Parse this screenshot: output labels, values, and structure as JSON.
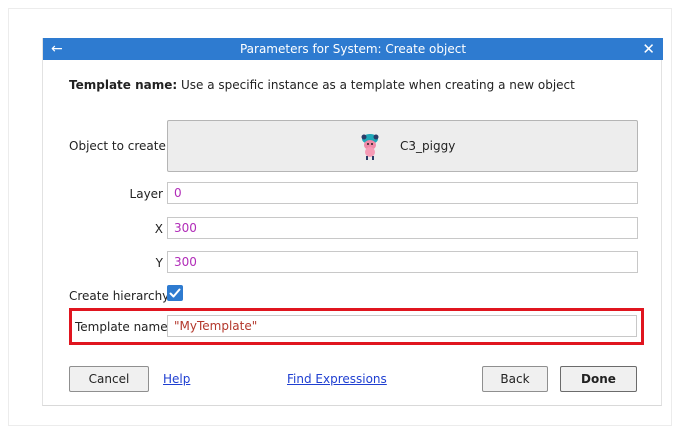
{
  "dialog": {
    "title": "Parameters for System: Create object",
    "back_glyph": "←",
    "close_glyph": "✕",
    "description_label": "Template name:",
    "description_text": "Use a specific instance as a template when creating a new object"
  },
  "params": {
    "object_label": "Object to create",
    "object_value": "C3_piggy",
    "layer_label": "Layer",
    "layer_value": "0",
    "x_label": "X",
    "x_value": "300",
    "y_label": "Y",
    "y_value": "300",
    "hierarchy_label": "Create hierarchy",
    "hierarchy_checked": true,
    "template_label": "Template name",
    "template_value": "\"MyTemplate\""
  },
  "footer": {
    "cancel_label": "Cancel",
    "help_label": "Help",
    "find_expressions_label": "Find Expressions",
    "back_label": "Back",
    "done_label": "Done"
  },
  "colors": {
    "titlebar": "#2e7bd0",
    "highlight": "#e0151f",
    "number_value": "#b12cb8",
    "string_value": "#b3372b",
    "link": "#1f3fd1"
  },
  "icons": {
    "object": "piggy-sprite-icon",
    "checkbox": "checkmark-icon"
  }
}
